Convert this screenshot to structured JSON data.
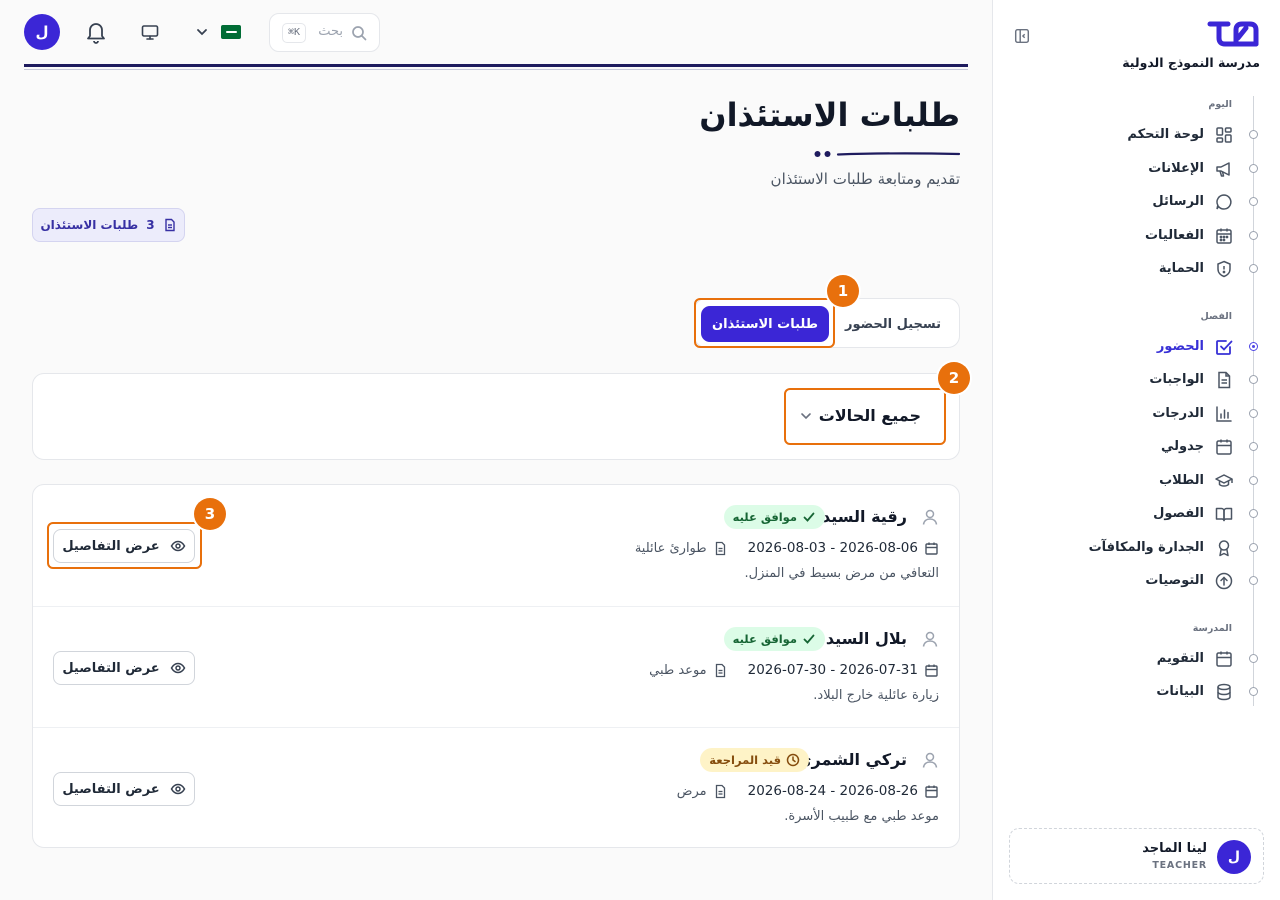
{
  "sidebar": {
    "school_name": "مدرسة النموذج الدولية",
    "sections": [
      {
        "label": "اليوم",
        "items": [
          {
            "label": "لوحة التحكم",
            "icon": "dashboard-icon"
          },
          {
            "label": "الإعلانات",
            "icon": "megaphone-icon"
          },
          {
            "label": "الرسائل",
            "icon": "chat-icon"
          },
          {
            "label": "الفعاليات",
            "icon": "calendar-grid-icon"
          },
          {
            "label": "الحماية",
            "icon": "shield-icon"
          }
        ]
      },
      {
        "label": "الفصل",
        "items": [
          {
            "label": "الحضور",
            "icon": "checkbox-icon",
            "active": true
          },
          {
            "label": "الواجبات",
            "icon": "document-icon"
          },
          {
            "label": "الدرجات",
            "icon": "bar-chart-icon"
          },
          {
            "label": "جدولي",
            "icon": "calendar-icon"
          },
          {
            "label": "الطلاب",
            "icon": "graduation-cap-icon"
          },
          {
            "label": "الفصول",
            "icon": "book-icon"
          },
          {
            "label": "الجدارة والمكافآت",
            "icon": "award-icon"
          },
          {
            "label": "التوصيات",
            "icon": "arrow-up-circle-icon"
          }
        ]
      },
      {
        "label": "المدرسة",
        "items": [
          {
            "label": "التقويم",
            "icon": "calendar-icon"
          },
          {
            "label": "البيانات",
            "icon": "database-icon"
          }
        ]
      }
    ],
    "user": {
      "initial": "ل",
      "name": "لينا الماجد",
      "role": "TEACHER"
    }
  },
  "topbar": {
    "avatar_initial": "ل",
    "search_placeholder": "بحث",
    "search_shortcut": "K⌘"
  },
  "header": {
    "title": "طلبات الاستئذان",
    "subtitle": "تقديم ومتابعة طلبات الاستئذان",
    "count": "3",
    "count_label": "طلبات الاستئذان"
  },
  "tabs": {
    "attendance": "تسجيل الحضور",
    "permission_requests": "طلبات الاستئذان"
  },
  "filter": {
    "status": "جميع الحالات"
  },
  "annotations": [
    "1",
    "2",
    "3"
  ],
  "requests": [
    {
      "name": "رقية السيد",
      "status": "موافق عليه",
      "status_kind": "approved",
      "dates": "2026-08-03 - 2026-08-06",
      "type": "طوارئ عائلية",
      "reason": "التعافي من مرض بسيط في المنزل.",
      "action": "عرض التفاصيل"
    },
    {
      "name": "بلال السيد",
      "status": "موافق عليه",
      "status_kind": "approved",
      "dates": "2026-07-30 - 2026-07-31",
      "type": "موعد طبي",
      "reason": "زيارة عائلية خارج البلاد.",
      "action": "عرض التفاصيل"
    },
    {
      "name": "تركي الشمري",
      "status": "قيد المراجعة",
      "status_kind": "pending",
      "dates": "2026-08-24 - 2026-08-26",
      "type": "مرض",
      "reason": "موعد طبي مع طبيب الأسرة.",
      "action": "عرض التفاصيل"
    }
  ],
  "colors": {
    "brand": "#3b26d6",
    "annotation": "#e8700c",
    "approved_bg": "#dcfce7",
    "pending_bg": "#fef3c7"
  }
}
